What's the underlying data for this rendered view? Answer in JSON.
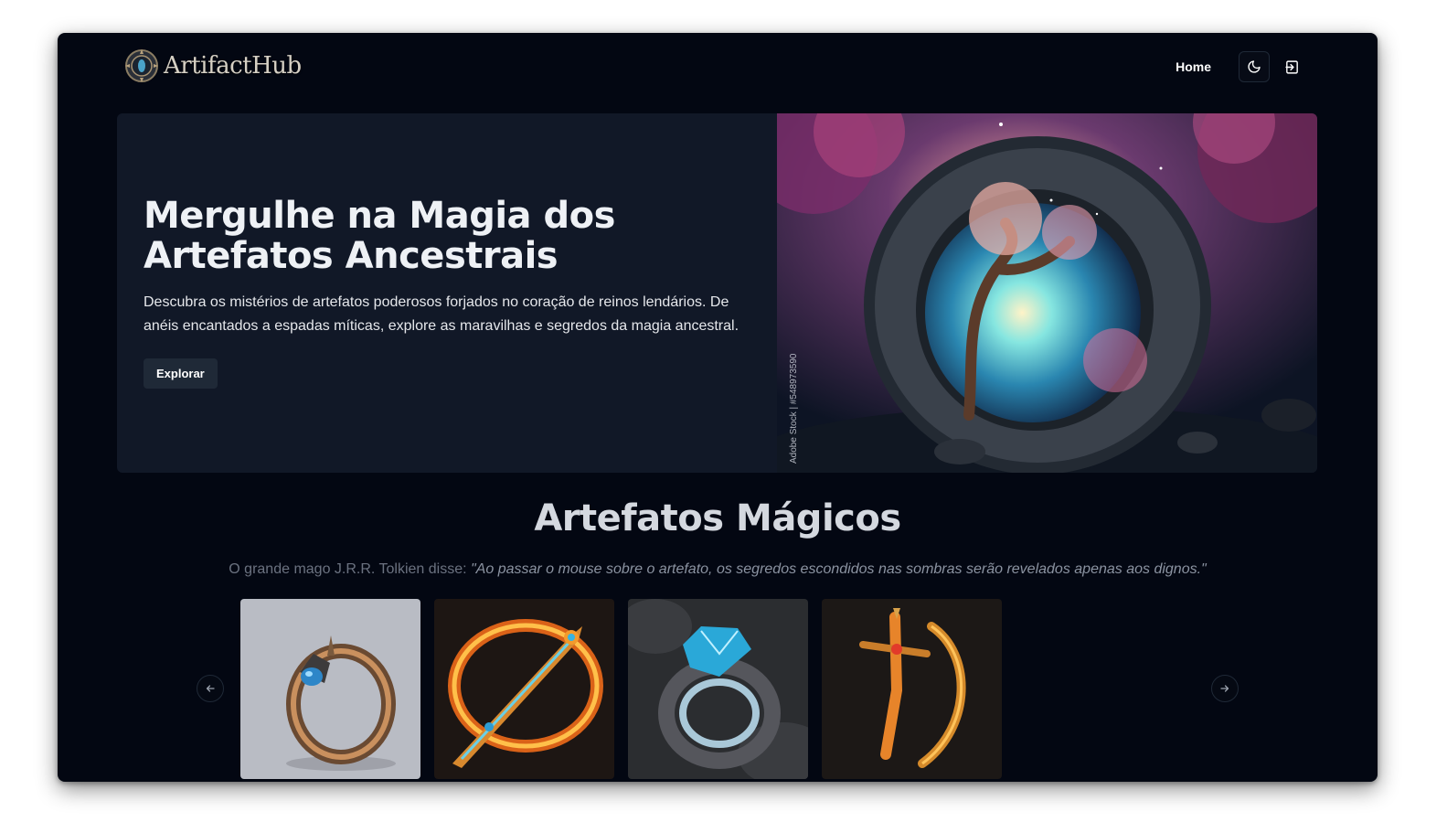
{
  "header": {
    "logo_text": "ArtifactHub",
    "nav_home": "Home",
    "theme_icon": "moon-icon",
    "login_icon": "sign-in-icon"
  },
  "hero": {
    "title_line1": "Mergulhe na Magia dos",
    "title_line2": "Artefatos Ancestrais",
    "description": "Descubra os mistérios de artefatos poderosos forjados no coração de reinos lendários. De anéis encantados a espadas míticas, explore as maravilhas e segredos da magia ancestral.",
    "button_label": "Explorar",
    "image_watermark": "Adobe Stock | #548973590"
  },
  "section": {
    "title": "Artefatos Mágicos",
    "quote_prefix": "O grande mago J.R.R. Tolkien disse: ",
    "quote_text": "\"Ao passar o mouse sobre o artefato, os segredos escondidos nas sombras serão revelados apenas aos dignos.\""
  },
  "carousel": {
    "prev_icon": "arrow-left-icon",
    "next_icon": "arrow-right-icon",
    "items": [
      "ring-blue-gem",
      "flaming-sword",
      "crystal-ring",
      "golden-bow"
    ]
  },
  "colors": {
    "background": "#030712",
    "hero_panel": "#111827",
    "button": "#1f2937"
  }
}
